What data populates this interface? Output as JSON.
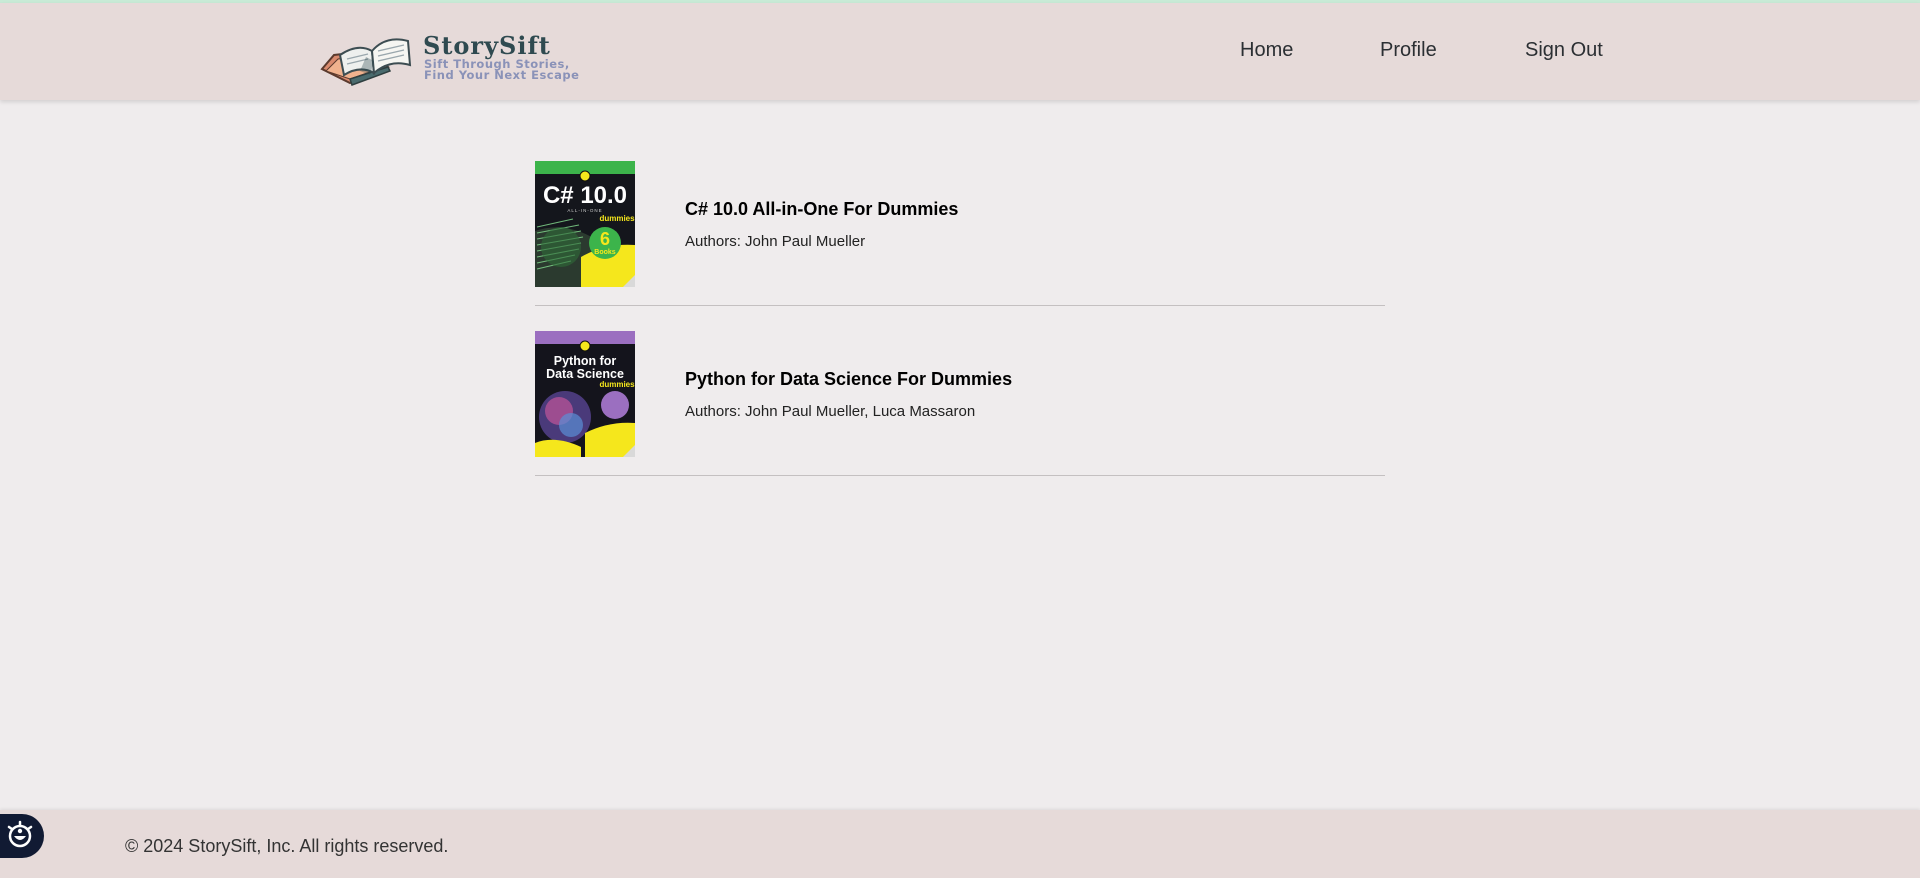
{
  "header": {
    "logo": {
      "title": "StorySift",
      "tagline_line1": "Sift Through Stories,",
      "tagline_line2": "Find Your Next Escape",
      "icon": "open-book-icon"
    },
    "nav": [
      {
        "label": "Home"
      },
      {
        "label": "Profile"
      },
      {
        "label": "Sign Out"
      }
    ]
  },
  "books": [
    {
      "title": "C# 10.0 All-in-One For Dummies",
      "authors_label": "Authors:",
      "authors": "John Paul Mueller",
      "cover": {
        "top_text": "C# 10.0",
        "sub_text": "ALL-IN-ONE",
        "brand": "dummies",
        "badge_number": "6",
        "badge_text": "Books",
        "band_color": "#3cb44b"
      }
    },
    {
      "title": "Python for Data Science For Dummies",
      "authors_label": "Authors:",
      "authors": "John Paul Mueller, Luca Massaron",
      "cover": {
        "top_text_1": "Python for",
        "top_text_2": "Data Science",
        "brand": "dummies",
        "band_color": "#9b6fc0"
      }
    }
  ],
  "footer": {
    "copyright": "© 2024 StorySift, Inc. All rights reserved."
  },
  "accessibility": {
    "icon": "accessibility-icon"
  },
  "colors": {
    "header_bg": "#e6dad9",
    "page_bg": "#efeced",
    "dummies_yellow": "#f5e71c"
  }
}
